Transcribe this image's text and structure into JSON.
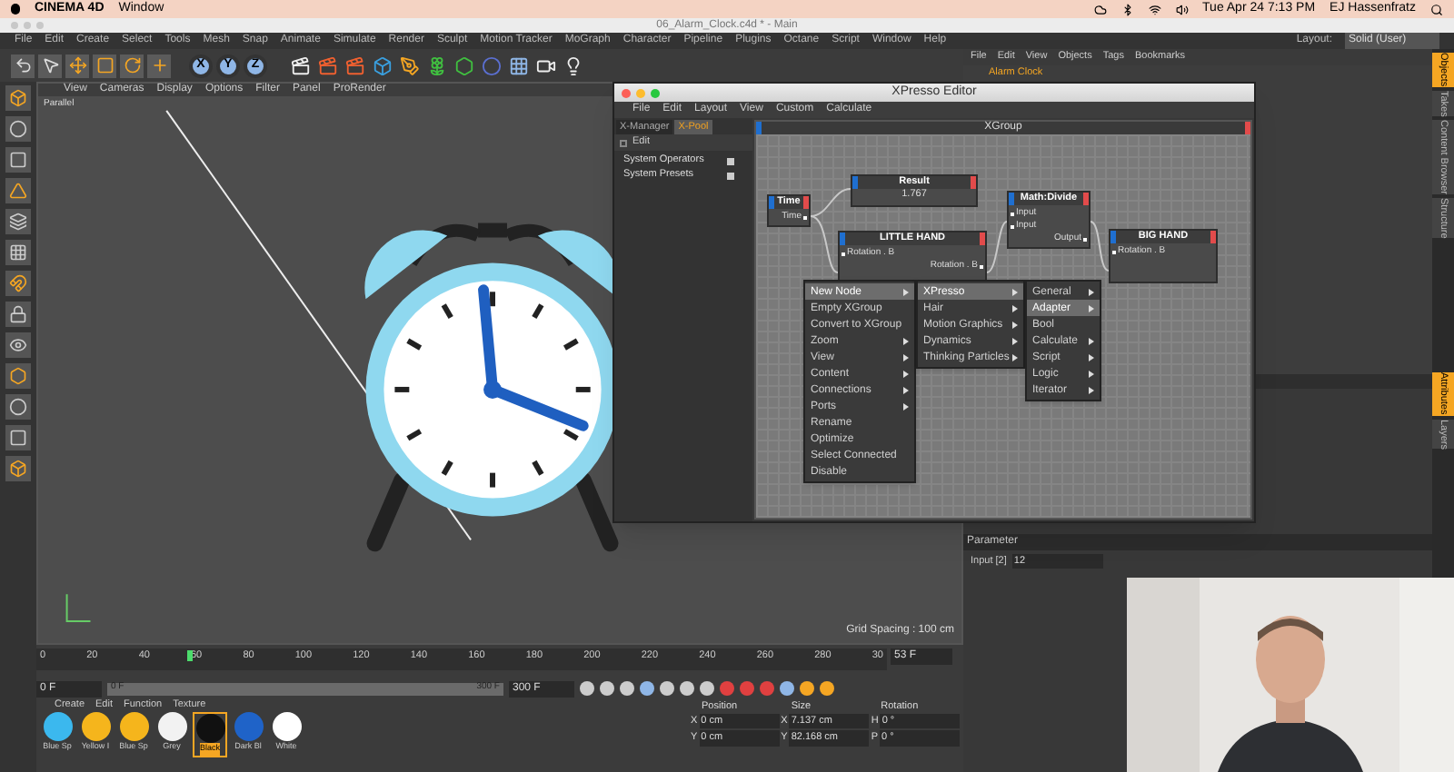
{
  "menubar": {
    "app": "CINEMA 4D",
    "items": [
      "Window"
    ],
    "clock": "Tue Apr 24  7:13 PM",
    "user": "EJ Hassenfratz"
  },
  "window_title": "06_Alarm_Clock.c4d * - Main",
  "main_menu": [
    "File",
    "Edit",
    "Create",
    "Select",
    "Tools",
    "Mesh",
    "Snap",
    "Animate",
    "Simulate",
    "Render",
    "Sculpt",
    "Motion Tracker",
    "MoGraph",
    "Character",
    "Pipeline",
    "Plugins",
    "Octane",
    "Script",
    "Window",
    "Help"
  ],
  "layout": {
    "label": "Layout:",
    "value": "Solid (User)"
  },
  "axis_buttons": [
    "X",
    "Y",
    "Z"
  ],
  "viewport": {
    "menu": [
      "View",
      "Cameras",
      "Display",
      "Options",
      "Filter",
      "Panel",
      "ProRender"
    ],
    "camera": "Parallel",
    "grid_spacing": "Grid Spacing : 100 cm"
  },
  "timeline": {
    "ticks": [
      "0",
      "20",
      "40",
      "60",
      "80",
      "100",
      "120",
      "140",
      "160",
      "180",
      "200",
      "220",
      "240",
      "260",
      "280",
      "30"
    ],
    "level": 0.177,
    "current": "53 F"
  },
  "transport": {
    "level": 1,
    "start": "0 F",
    "range_start": "0 F",
    "range_end": "300 F",
    "end": "300 F"
  },
  "materials": {
    "menu": [
      "Create",
      "Edit",
      "Function",
      "Texture"
    ],
    "swatches": [
      {
        "label": "Blue Sp",
        "color": "#3bb8ee",
        "selected": false
      },
      {
        "label": "Yellow I",
        "color": "#f5b51c",
        "selected": false
      },
      {
        "label": "Blue Sp",
        "color": "#f5b51c",
        "selected": false
      },
      {
        "label": "Grey",
        "color": "#f2f2f2",
        "selected": false
      },
      {
        "label": "Black",
        "color": "#111111",
        "selected": true
      },
      {
        "label": "Dark Bl",
        "color": "#1f63c8",
        "selected": false
      },
      {
        "label": "White",
        "color": "#ffffff",
        "selected": false
      }
    ]
  },
  "coordinates": {
    "headers": [
      "Position",
      "Size",
      "Rotation"
    ],
    "rows": [
      [
        {
          "axis": "X",
          "value": "0 cm"
        },
        {
          "axis": "X",
          "value": "7.137 cm"
        },
        {
          "axis": "H",
          "value": "0 °"
        }
      ],
      [
        {
          "axis": "Y",
          "value": "0 cm"
        },
        {
          "axis": "Y",
          "value": "82.168 cm"
        },
        {
          "axis": "P",
          "value": "0 °"
        }
      ]
    ]
  },
  "object_manager": {
    "menu": [
      "File",
      "Edit",
      "View",
      "Objects",
      "Tags",
      "Bookmarks"
    ],
    "objects": [
      "Alarm Clock"
    ]
  },
  "side_tabs": [
    {
      "label": "Objects",
      "selected": true
    },
    {
      "label": "Takes",
      "selected": false
    },
    {
      "label": "Content Browser",
      "selected": false
    },
    {
      "label": "Structure",
      "selected": false
    }
  ],
  "side_tabs_lower": [
    {
      "label": "Attributes",
      "selected": true
    },
    {
      "label": "Layers",
      "selected": false
    }
  ],
  "attributes": {
    "section": "Parameter",
    "fields": [
      {
        "label": "Input [2]",
        "value": "12"
      }
    ]
  },
  "xpresso": {
    "title": "XPresso Editor",
    "menu": [
      "File",
      "Edit",
      "Layout",
      "View",
      "Custom",
      "Calculate"
    ],
    "tabs": [
      {
        "label": "X-Manager",
        "selected": false
      },
      {
        "label": "X-Pool",
        "selected": true
      }
    ],
    "pool_menu": "Edit",
    "pool_items": [
      "System Operators",
      "System Presets"
    ],
    "group": "XGroup",
    "nodes": [
      {
        "title": "Time",
        "ports": [
          {
            "label": "Time",
            "kind": "output"
          }
        ]
      },
      {
        "title": "Result",
        "value": "1.767"
      },
      {
        "title": "LITTLE HAND",
        "ports": [
          {
            "label": "Rotation . B",
            "kind": "input"
          },
          {
            "label": "Rotation . B",
            "kind": "output"
          }
        ]
      },
      {
        "title": "Math:Divide",
        "ports": [
          {
            "label": "Input",
            "kind": "input"
          },
          {
            "label": "Input",
            "kind": "input"
          },
          {
            "label": "Output",
            "kind": "output"
          }
        ]
      },
      {
        "title": "BIG HAND",
        "ports": [
          {
            "label": "Rotation . B",
            "kind": "input"
          }
        ]
      }
    ],
    "context_menu": [
      {
        "label": "New Node",
        "submenu": true,
        "selected": true
      },
      {
        "label": "Empty XGroup",
        "submenu": false,
        "selected": false
      },
      {
        "label": "Convert to XGroup",
        "submenu": false,
        "selected": false
      },
      {
        "label": "Zoom",
        "submenu": true,
        "selected": false
      },
      {
        "label": "View",
        "submenu": true,
        "selected": false
      },
      {
        "label": "Content",
        "submenu": true,
        "selected": false
      },
      {
        "label": "Connections",
        "submenu": true,
        "selected": false
      },
      {
        "label": "Ports",
        "submenu": true,
        "selected": false
      },
      {
        "label": "Rename",
        "submenu": false,
        "selected": false
      },
      {
        "label": "Optimize",
        "submenu": false,
        "selected": false
      },
      {
        "label": "Select Connected",
        "submenu": false,
        "selected": false
      },
      {
        "label": "Disable",
        "submenu": false,
        "selected": false
      }
    ],
    "submenu": [
      {
        "label": "XPresso",
        "submenu": true,
        "selected": true
      },
      {
        "label": "Hair",
        "submenu": true,
        "selected": false
      },
      {
        "label": "Motion Graphics",
        "submenu": true,
        "selected": false
      },
      {
        "label": "Dynamics",
        "submenu": true,
        "selected": false
      },
      {
        "label": "Thinking Particles",
        "submenu": true,
        "selected": false
      }
    ],
    "submenu2": [
      {
        "label": "General",
        "submenu": true,
        "selected": false
      },
      {
        "label": "Adapter",
        "submenu": true,
        "selected": true
      },
      {
        "label": "Bool",
        "submenu": false,
        "selected": false
      },
      {
        "label": "Calculate",
        "submenu": true,
        "selected": false
      },
      {
        "label": "Script",
        "submenu": true,
        "selected": false
      },
      {
        "label": "Logic",
        "submenu": true,
        "selected": false
      },
      {
        "label": "Iterator",
        "submenu": true,
        "selected": false
      }
    ]
  },
  "webcam": {
    "kind": "picture"
  }
}
